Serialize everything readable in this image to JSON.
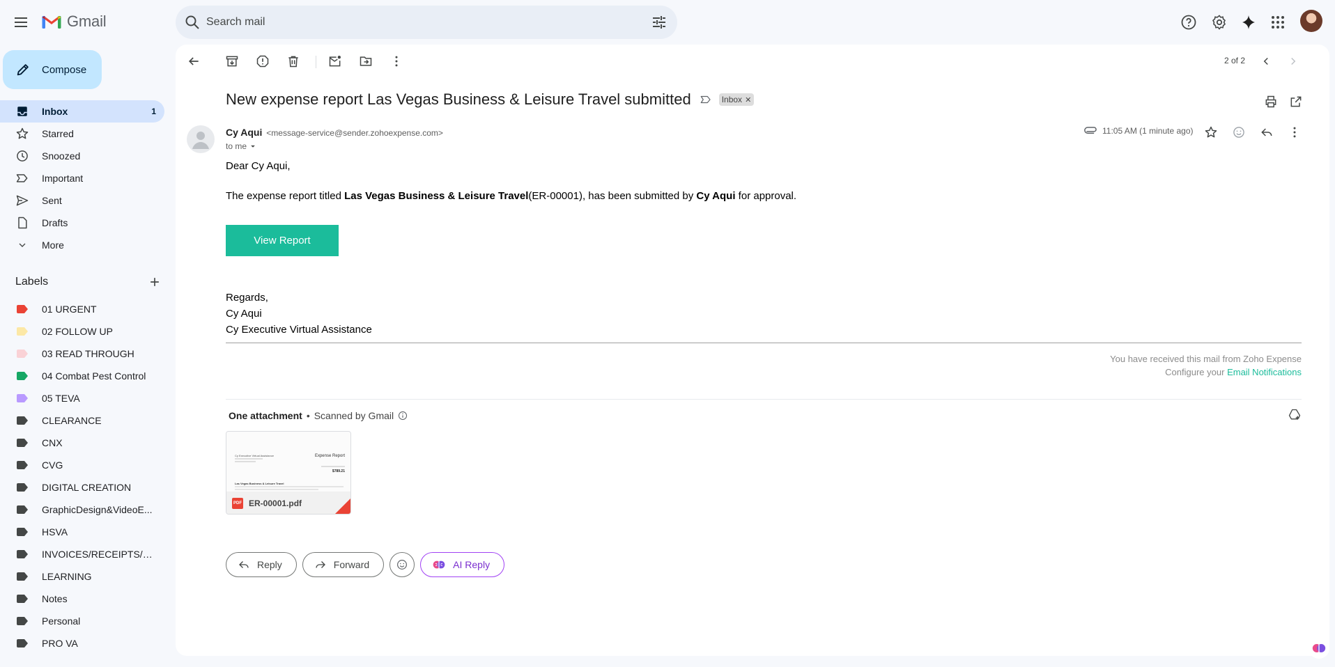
{
  "app": {
    "name": "Gmail"
  },
  "search": {
    "placeholder": "Search mail"
  },
  "compose": {
    "label": "Compose"
  },
  "nav": [
    {
      "label": "Inbox",
      "count": "1",
      "icon": "inbox-icon"
    },
    {
      "label": "Starred",
      "count": "",
      "icon": "star-icon"
    },
    {
      "label": "Snoozed",
      "count": "",
      "icon": "clock-icon"
    },
    {
      "label": "Important",
      "count": "",
      "icon": "label-important-icon"
    },
    {
      "label": "Sent",
      "count": "",
      "icon": "send-icon"
    },
    {
      "label": "Drafts",
      "count": "",
      "icon": "draft-icon"
    },
    {
      "label": "More",
      "count": "",
      "icon": "chevron-down-icon"
    }
  ],
  "labels_header": "Labels",
  "labels": [
    {
      "label": "01 URGENT",
      "color": "#ea4335"
    },
    {
      "label": "02 FOLLOW UP",
      "color": "#fce8a6"
    },
    {
      "label": "03 READ THROUGH",
      "color": "#fad2d6"
    },
    {
      "label": "04 Combat Pest Control",
      "color": "#16a765"
    },
    {
      "label": "05 TEVA",
      "color": "#b99aff"
    },
    {
      "label": "CLEARANCE",
      "color": "#444746"
    },
    {
      "label": "CNX",
      "color": "#444746"
    },
    {
      "label": "CVG",
      "color": "#444746"
    },
    {
      "label": "DIGITAL CREATION",
      "color": "#444746"
    },
    {
      "label": "GraphicDesign&VideoE...",
      "color": "#444746"
    },
    {
      "label": "HSVA",
      "color": "#444746"
    },
    {
      "label": "INVOICES/RECEIPTS/BIL...",
      "color": "#444746"
    },
    {
      "label": "LEARNING",
      "color": "#444746"
    },
    {
      "label": "Notes",
      "color": "#444746"
    },
    {
      "label": "Personal",
      "color": "#444746"
    },
    {
      "label": "PRO VA",
      "color": "#444746"
    }
  ],
  "pager": {
    "text": "2 of 2"
  },
  "email": {
    "subject": "New expense report Las Vegas Business & Leisure Travel submitted",
    "inbox_chip": "Inbox",
    "sender_name": "Cy Aqui",
    "sender_email": "<message-service@sender.zohoexpense.com>",
    "to": "to me",
    "time": "11:05 AM (1 minute ago)",
    "greeting": "Dear Cy Aqui,",
    "body_pre": "The expense report titled ",
    "body_report": "Las Vegas Business & Leisure Travel",
    "body_mid": "(ER-00001), has been submitted by ",
    "body_submitter": "Cy Aqui",
    "body_post": " for approval.",
    "view_button": "View Report",
    "regards": "Regards,",
    "sig_name": "Cy Aqui",
    "sig_company": "Cy Executive Virtual Assistance",
    "footer_line1": "You have received this mail from Zoho Expense",
    "footer_line2_pre": "Configure your ",
    "footer_link": "Email Notifications"
  },
  "attachments": {
    "heading": "One attachment",
    "scanned": "Scanned by Gmail",
    "file_name": "ER-00001.pdf",
    "file_type": "PDF",
    "preview_company": "Cy Executive Virtual Assistance",
    "preview_title": "Expense Report",
    "preview_amount": "$789.21",
    "preview_report": "Las Vegas Business & Leisure Travel"
  },
  "actions": {
    "reply": "Reply",
    "forward": "Forward",
    "ai_reply": "AI Reply"
  },
  "colors": {
    "accent_teal": "#1bbc9b",
    "compose_bg": "#c2e7ff",
    "active_nav": "#d3e3fd"
  }
}
